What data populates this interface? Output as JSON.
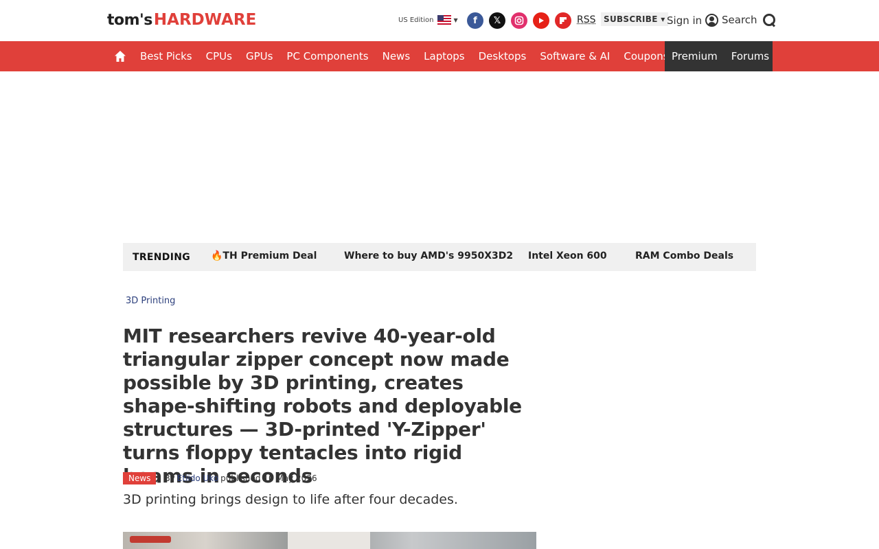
{
  "header": {
    "logo_toms": "tom's",
    "logo_hardware": "HARDWARE",
    "edition_label": "US Edition",
    "rss_label": "RSS",
    "subscribe_label": "SUBSCRIBE ▾",
    "signin_label": "Sign in",
    "search_label": "Search"
  },
  "nav": {
    "items": [
      "Best Picks",
      "CPUs",
      "GPUs",
      "PC Components",
      "News",
      "Laptops",
      "Desktops",
      "Software & AI",
      "Coupons"
    ],
    "premium": "Premium",
    "forums": "Forums"
  },
  "trending": {
    "label": "TRENDING",
    "items": [
      "🔥TH Premium Deal",
      "Where to buy AMD's 9950X3D2",
      "Intel Xeon 600",
      "RAM Combo Deals"
    ]
  },
  "article": {
    "category": "3D Printing",
    "title": "MIT researchers revive 40-year-old triangular zipper concept now made possible by 3D printing, creates shape-shifting robots and deployable structures — 3D-printed 'Y-Zipper' turns floppy tentacles into rigid beams in seconds",
    "badge": "News",
    "by": "By",
    "author": "Etiido Uko",
    "published": "published 10 May 2026",
    "subtitle": "3D printing brings design to life after four decades."
  },
  "colors": {
    "brand_red": "#e0403a",
    "nav_dark": "#333333",
    "link_blue": "#2c3f7c"
  }
}
